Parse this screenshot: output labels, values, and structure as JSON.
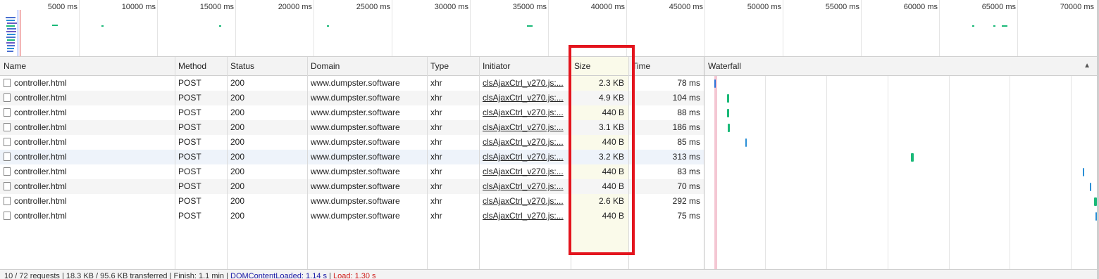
{
  "overview": {
    "tick_labels": [
      "5000 ms",
      "10000 ms",
      "15000 ms",
      "20000 ms",
      "25000 ms",
      "30000 ms",
      "35000 ms",
      "40000 ms",
      "45000 ms",
      "50000 ms",
      "55000 ms",
      "60000 ms",
      "65000 ms",
      "70000 ms"
    ]
  },
  "columns": {
    "name": "Name",
    "method": "Method",
    "status": "Status",
    "domain": "Domain",
    "type": "Type",
    "initiator": "Initiator",
    "size": "Size",
    "time": "Time",
    "waterfall": "Waterfall"
  },
  "rows": [
    {
      "name": "controller.html",
      "method": "POST",
      "status": "200",
      "domain": "www.dumpster.software",
      "type": "xhr",
      "initiator": "clsAjaxCtrl_v270.js:...",
      "size": "2.3 KB",
      "time": "78 ms"
    },
    {
      "name": "controller.html",
      "method": "POST",
      "status": "200",
      "domain": "www.dumpster.software",
      "type": "xhr",
      "initiator": "clsAjaxCtrl_v270.js:...",
      "size": "4.9 KB",
      "time": "104 ms"
    },
    {
      "name": "controller.html",
      "method": "POST",
      "status": "200",
      "domain": "www.dumpster.software",
      "type": "xhr",
      "initiator": "clsAjaxCtrl_v270.js:...",
      "size": "440 B",
      "time": "88 ms"
    },
    {
      "name": "controller.html",
      "method": "POST",
      "status": "200",
      "domain": "www.dumpster.software",
      "type": "xhr",
      "initiator": "clsAjaxCtrl_v270.js:...",
      "size": "3.1 KB",
      "time": "186 ms"
    },
    {
      "name": "controller.html",
      "method": "POST",
      "status": "200",
      "domain": "www.dumpster.software",
      "type": "xhr",
      "initiator": "clsAjaxCtrl_v270.js:...",
      "size": "440 B",
      "time": "85 ms"
    },
    {
      "name": "controller.html",
      "method": "POST",
      "status": "200",
      "domain": "www.dumpster.software",
      "type": "xhr",
      "initiator": "clsAjaxCtrl_v270.js:...",
      "size": "3.2 KB",
      "time": "313 ms"
    },
    {
      "name": "controller.html",
      "method": "POST",
      "status": "200",
      "domain": "www.dumpster.software",
      "type": "xhr",
      "initiator": "clsAjaxCtrl_v270.js:...",
      "size": "440 B",
      "time": "83 ms"
    },
    {
      "name": "controller.html",
      "method": "POST",
      "status": "200",
      "domain": "www.dumpster.software",
      "type": "xhr",
      "initiator": "clsAjaxCtrl_v270.js:...",
      "size": "440 B",
      "time": "70 ms"
    },
    {
      "name": "controller.html",
      "method": "POST",
      "status": "200",
      "domain": "www.dumpster.software",
      "type": "xhr",
      "initiator": "clsAjaxCtrl_v270.js:...",
      "size": "2.6 KB",
      "time": "292 ms"
    },
    {
      "name": "controller.html",
      "method": "POST",
      "status": "200",
      "domain": "www.dumpster.software",
      "type": "xhr",
      "initiator": "clsAjaxCtrl_v270.js:...",
      "size": "440 B",
      "time": "75 ms"
    }
  ],
  "status_bar": {
    "summary": "10 / 72 requests | 18.3 KB / 95.6 KB transferred | Finish: 1.1 min | ",
    "dom_content_loaded": "DOMContentLoaded: 1.14 s",
    "separator": " | ",
    "load": "Load: 1.30 s"
  },
  "colors": {
    "highlight_box": "#e3141d",
    "waterfall_green": "#1ab978",
    "waterfall_blue": "#2a8fd6"
  },
  "icons": {
    "file": "file-icon",
    "sort": "sort-triangle-icon"
  }
}
